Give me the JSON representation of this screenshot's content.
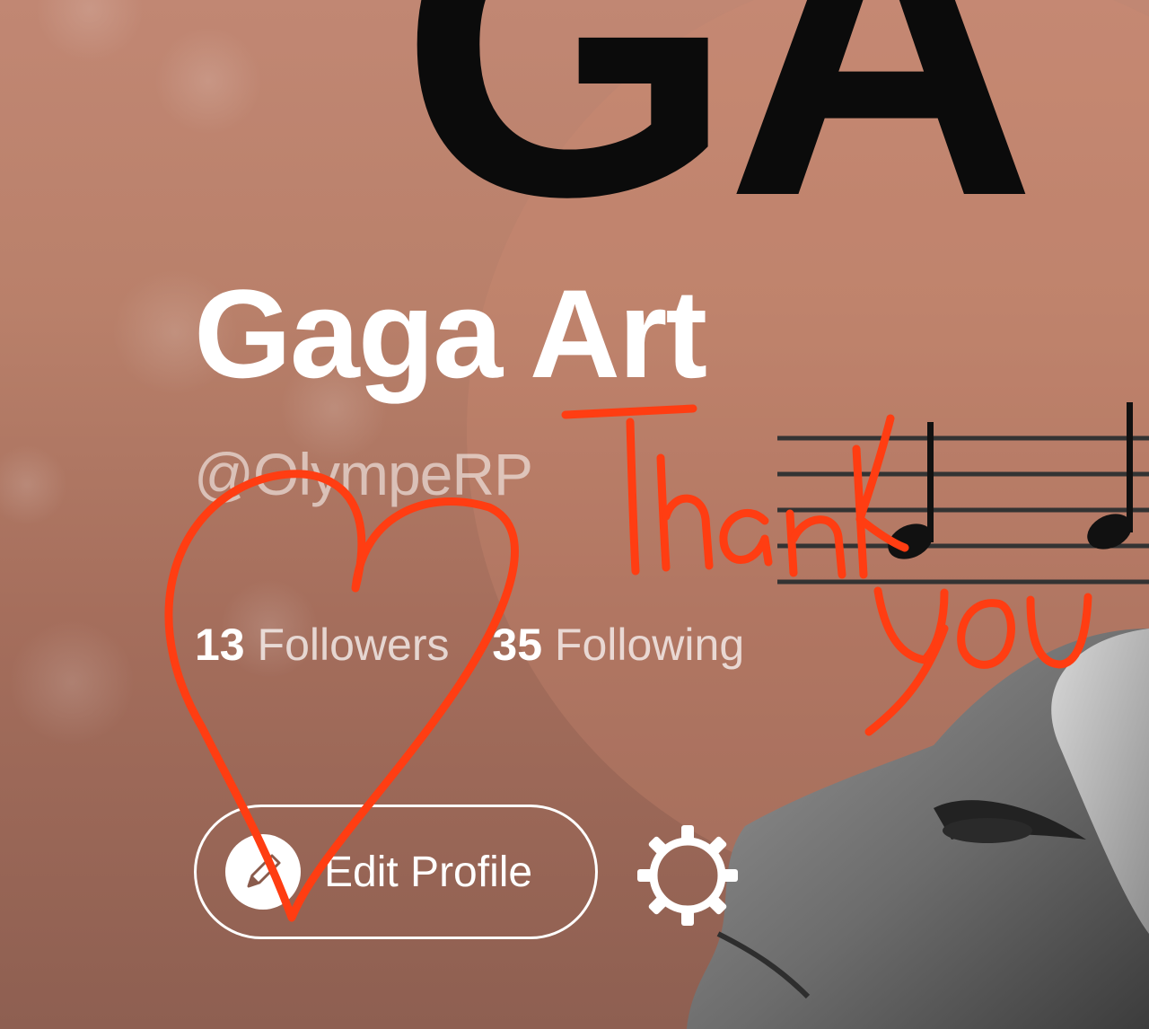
{
  "banner": {
    "large_letters": "GA"
  },
  "profile": {
    "name": "Gaga Art",
    "handle": "@OlympeRP",
    "followers_count": "13",
    "followers_label": "Followers",
    "following_count": "35",
    "following_label": "Following"
  },
  "actions": {
    "edit_profile_label": "Edit Profile",
    "edit_icon": "pencil-icon",
    "settings_icon": "gear-icon"
  },
  "annotation": {
    "line1": "Thank",
    "line2": "You",
    "shape": "heart",
    "color": "#ff3d12"
  },
  "colors": {
    "background": "#b9806a",
    "text": "#ffffff",
    "ink": "#ff3d12"
  }
}
